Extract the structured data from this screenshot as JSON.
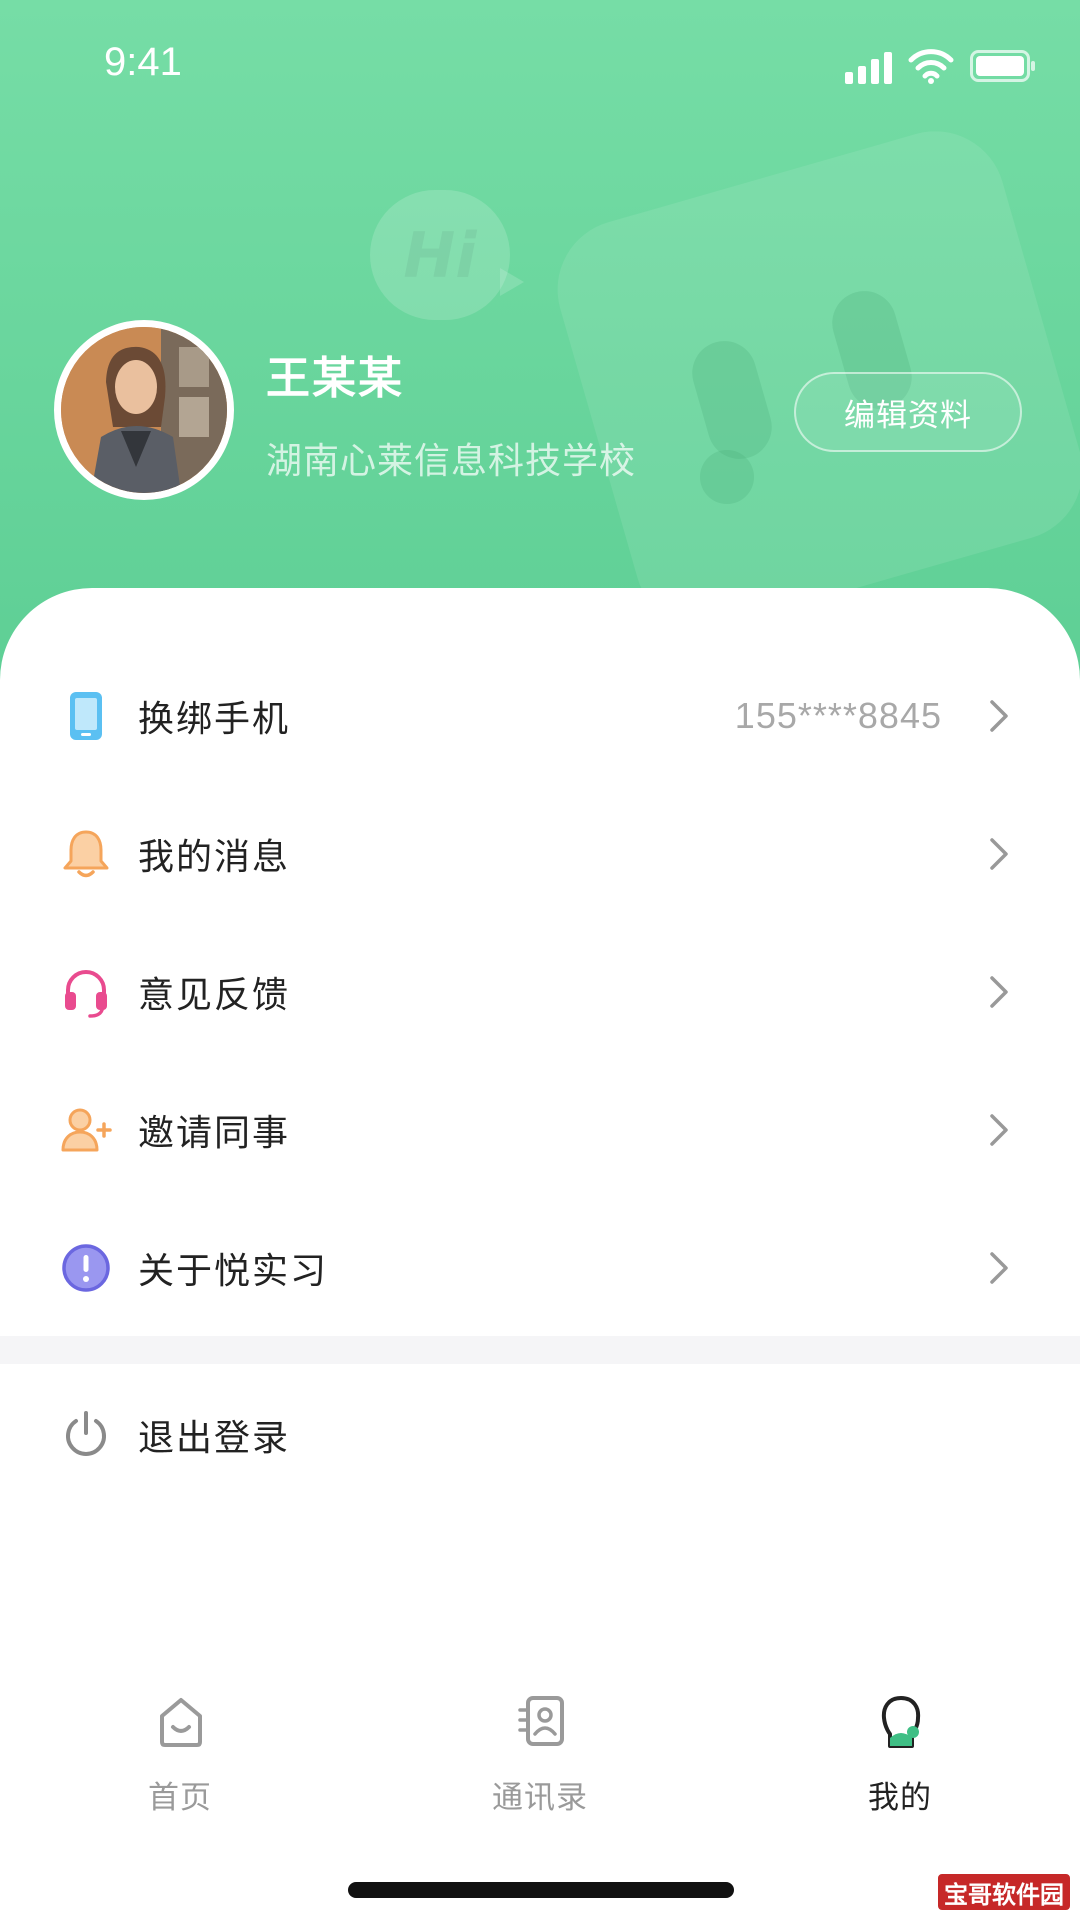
{
  "status_bar": {
    "time": "9:41"
  },
  "profile": {
    "name": "王某某",
    "school": "湖南心莱信息科技学校",
    "edit_label": "编辑资料",
    "decoration_text": "Hi"
  },
  "menu": {
    "items": [
      {
        "label": "换绑手机",
        "value": "155****8845",
        "icon": "phone-icon",
        "color": "#5bc0f2"
      },
      {
        "label": "我的消息",
        "value": "",
        "icon": "bell-icon",
        "color": "#f5a55b"
      },
      {
        "label": "意见反馈",
        "value": "",
        "icon": "headset-icon",
        "color": "#e94b8f"
      },
      {
        "label": "邀请同事",
        "value": "",
        "icon": "add-user-icon",
        "color": "#f5a55b"
      },
      {
        "label": "关于悦实习",
        "value": "",
        "icon": "info-icon",
        "color": "#6b67e0"
      }
    ],
    "logout_label": "退出登录"
  },
  "tabbar": {
    "tabs": [
      {
        "label": "首页",
        "icon": "home-icon",
        "active": false
      },
      {
        "label": "通讯录",
        "icon": "contacts-icon",
        "active": false
      },
      {
        "label": "我的",
        "icon": "profile-icon",
        "active": true
      }
    ]
  },
  "watermark": {
    "text": "宝哥软件园"
  },
  "colors": {
    "header_gradient_top": "#76dda6",
    "header_gradient_bottom": "#5ecf95",
    "accent_green": "#5ecf95"
  }
}
